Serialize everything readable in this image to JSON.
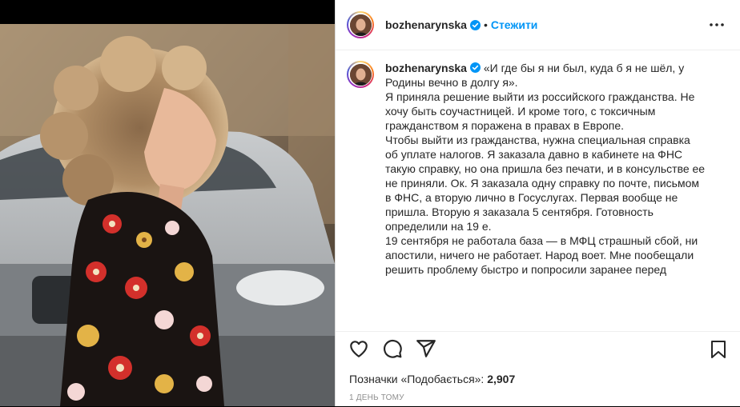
{
  "post": {
    "username": "bozhenarynska",
    "follow_label": "Стежити",
    "dot": "•",
    "caption": {
      "quote": "«И где бы я ни был, куда б я не шёл, у Родины вечно в долгу я».",
      "paragraphs": [
        "Я приняла решение выйти из российского гражданства. Не хочу быть соучастницей. И кроме того, с токсичным гражданством я поражена в правах в Европе.",
        "Чтобы выйти из гражданства, нужна специальная справка об уплате налогов. Я заказала давно в кабинете на ФНС такую справку, но она пришла без печати, и в консульстве ее не приняли. Ок. Я заказала одну справку по почте, письмом в ФНС, а вторую лично в Госуслугах. Первая вообще не пришла. Вторую я заказала 5 сентября. Готовность определили на 19 е.",
        "19 сентября не работала база — в МФЦ страшный сбой, ни апостили, ничего не работает. Народ воет. Мне пообещали решить проблему быстро и попросили заранее перед"
      ]
    },
    "likes_prefix": "Позначки «Подобається»: ",
    "likes_count": "2,907",
    "timestamp": "1 день тому"
  },
  "icons": {
    "verified": "verified-badge-icon",
    "more": "more-options-icon",
    "like": "heart-icon",
    "comment": "comment-icon",
    "share": "share-icon",
    "save": "bookmark-icon"
  },
  "colors": {
    "accent": "#0095f6",
    "text": "#262626",
    "muted": "#8e8e8e"
  }
}
